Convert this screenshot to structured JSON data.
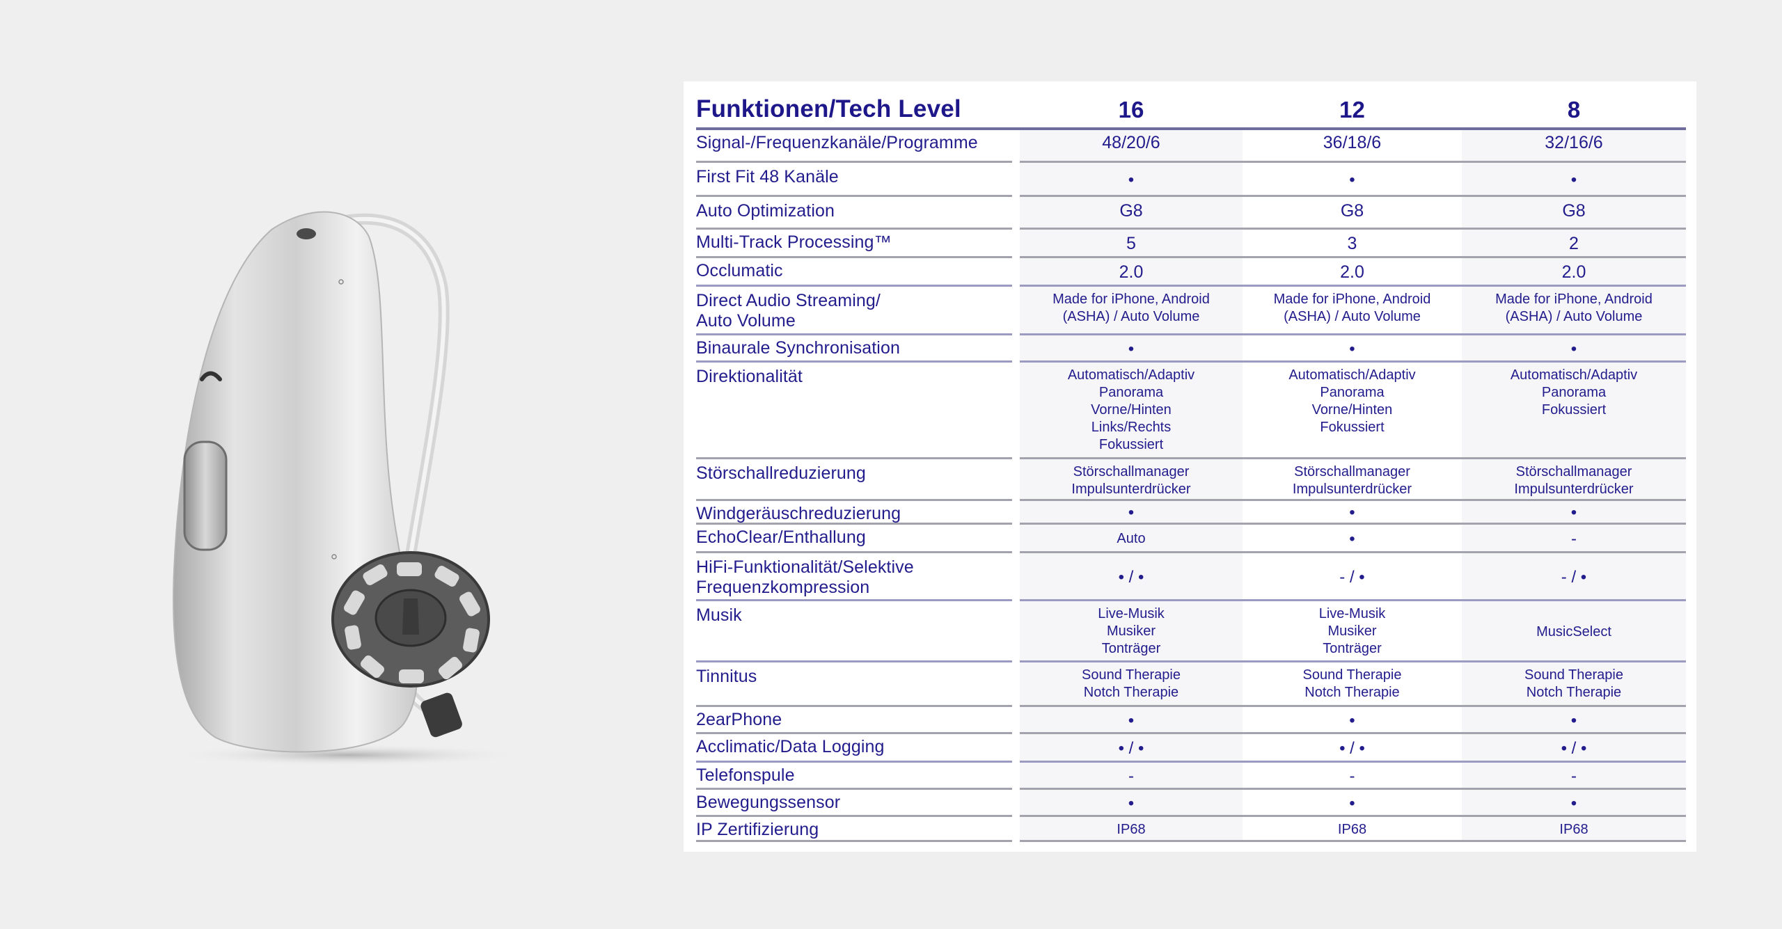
{
  "header": {
    "title": "Funktionen/Tech Level",
    "levels": [
      "16",
      "12",
      "8"
    ]
  },
  "rows": [
    {
      "label": "Signal-/Frequenzkanäle/Programme",
      "values": [
        "48/20/6",
        "36/18/6",
        "32/16/6"
      ],
      "big": true
    },
    {
      "label": "First Fit 48 Kanäle",
      "values": [
        "•",
        "•",
        "•"
      ]
    },
    {
      "label": "Auto Optimization",
      "values": [
        "G8",
        "G8",
        "G8"
      ],
      "big": true
    },
    {
      "label": "Multi-Track Processing™",
      "values": [
        "5",
        "3",
        "2"
      ],
      "big": true
    },
    {
      "label": "Occlumatic",
      "values": [
        "2.0",
        "2.0",
        "2.0"
      ],
      "big": true
    },
    {
      "label": "Direct Audio Streaming/\nAuto Volume",
      "values": [
        "Made for iPhone, Android\n(ASHA) / Auto Volume",
        "Made for iPhone, Android\n(ASHA) / Auto Volume",
        "Made for iPhone, Android\n(ASHA) / Auto Volume"
      ]
    },
    {
      "label": "Binaurale Synchronisation",
      "values": [
        "•",
        "•",
        "•"
      ]
    },
    {
      "label": "Direktionalität",
      "values": [
        "Automatisch/Adaptiv\nPanorama\nVorne/Hinten\nLinks/Rechts\nFokussiert",
        "Automatisch/Adaptiv\nPanorama\nVorne/Hinten\nFokussiert",
        "Automatisch/Adaptiv\nPanorama\nFokussiert"
      ]
    },
    {
      "label": "Störschallreduzierung",
      "values": [
        "Störschallmanager\nImpulsunterdrücker",
        "Störschallmanager\nImpulsunterdrücker",
        "Störschallmanager\nImpulsunterdrücker"
      ]
    },
    {
      "label": "Windgeräuschreduzierung",
      "values": [
        "•",
        "•",
        "•"
      ]
    },
    {
      "label": "EchoClear/Enthallung",
      "values": [
        "Auto",
        "•",
        "-"
      ]
    },
    {
      "label": "HiFi-Funktionalität/Selektive\nFrequenzkompression",
      "values": [
        "• / •",
        "- / •",
        "- / •"
      ]
    },
    {
      "label": "Musik",
      "values": [
        "Live-Musik\nMusiker\nTonträger",
        "Live-Musik\nMusiker\nTonträger",
        "MusicSelect"
      ]
    },
    {
      "label": "Tinnitus",
      "values": [
        "Sound Therapie\nNotch Therapie",
        "Sound Therapie\nNotch Therapie",
        "Sound Therapie\nNotch Therapie"
      ]
    },
    {
      "label": "2earPhone",
      "values": [
        "•",
        "•",
        "•"
      ]
    },
    {
      "label": "Acclimatic/Data Logging",
      "values": [
        "• / •",
        "• / •",
        "• / •"
      ]
    },
    {
      "label": "Telefonspule",
      "values": [
        "-",
        "-",
        "-"
      ]
    },
    {
      "label": "Bewegungssensor",
      "values": [
        "•",
        "•",
        "•"
      ]
    },
    {
      "label": "IP Zertifizierung",
      "values": [
        "IP68",
        "IP68",
        "IP68"
      ]
    }
  ],
  "product_image": {
    "subject": "hearing-aid-with-dome"
  },
  "colors": {
    "text": "#221c8c",
    "background": "#efefef",
    "panel": "#ffffff",
    "column_shade": "#f6f6f8"
  }
}
